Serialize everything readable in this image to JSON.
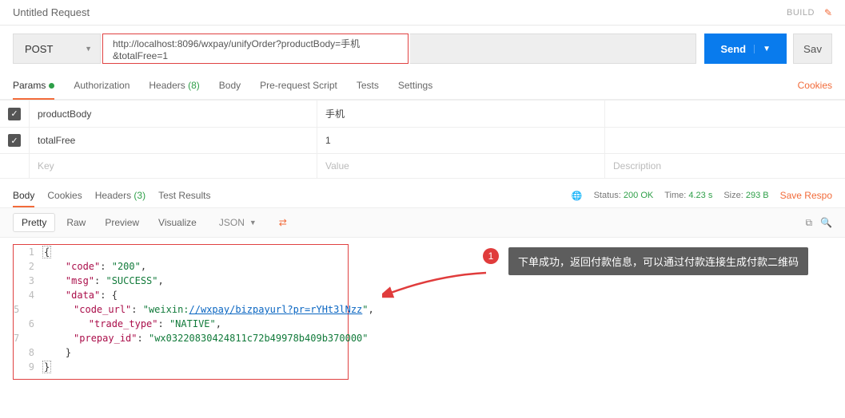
{
  "header": {
    "title": "Untitled Request",
    "build": "BUILD"
  },
  "request": {
    "method": "POST",
    "url": "http://localhost:8096/wxpay/unifyOrder?productBody=手机&totalFree=1",
    "send": "Send",
    "save": "Sav"
  },
  "reqTabs": {
    "params": "Params",
    "auth": "Authorization",
    "headers": "Headers",
    "headersCount": "(8)",
    "body": "Body",
    "prereq": "Pre-request Script",
    "tests": "Tests",
    "settings": "Settings",
    "cookies": "Cookies"
  },
  "paramsRows": [
    {
      "key": "productBody",
      "value": "手机"
    },
    {
      "key": "totalFree",
      "value": "1"
    }
  ],
  "paramsPlaceholder": {
    "key": "Key",
    "value": "Value",
    "desc": "Description"
  },
  "respTabs": {
    "body": "Body",
    "cookies": "Cookies",
    "headers": "Headers",
    "headersCount": "(3)",
    "results": "Test Results"
  },
  "status": {
    "statusLabel": "Status:",
    "statusVal": "200 OK",
    "timeLabel": "Time:",
    "timeVal": "4.23 s",
    "sizeLabel": "Size:",
    "sizeVal": "293 B",
    "saveResp": "Save Respo"
  },
  "viewBar": {
    "pretty": "Pretty",
    "raw": "Raw",
    "preview": "Preview",
    "visualize": "Visualize",
    "format": "JSON"
  },
  "responseBody": {
    "l1": "{",
    "l2a": "\"code\"",
    "l2b": ": ",
    "l2c": "\"200\"",
    "l2d": ",",
    "l3a": "\"msg\"",
    "l3b": ": ",
    "l3c": "\"SUCCESS\"",
    "l3d": ",",
    "l4a": "\"data\"",
    "l4b": ": {",
    "l5a": "\"code_url\"",
    "l5b": ": ",
    "l5c": "\"weixin:",
    "l5d": "//wxpay/bizpayurl?pr=rYHt3lNzz",
    "l5e": "\"",
    "l5f": ",",
    "l6a": "\"trade_type\"",
    "l6b": ": ",
    "l6c": "\"NATIVE\"",
    "l6d": ",",
    "l7a": "\"prepay_id\"",
    "l7b": ": ",
    "l7c": "\"wx03220830424811c72b49978b409b370000\"",
    "l8": "}",
    "l9": "}"
  },
  "lineNums": [
    "1",
    "2",
    "3",
    "4",
    "5",
    "6",
    "7",
    "8",
    "9"
  ],
  "callout": {
    "num": "1",
    "text": "下单成功，返回付款信息，可以通过付款连接生成付款二维码"
  }
}
